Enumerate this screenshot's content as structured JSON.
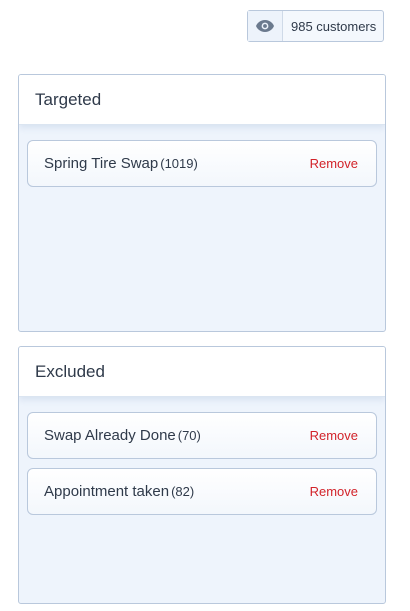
{
  "header": {
    "audience_count": "985 customers",
    "audience_icon": "eye-icon"
  },
  "colors": {
    "remove": "#d2232a",
    "panel_bg": "#eef4fc",
    "border": "#b9c8dc"
  },
  "targeted": {
    "title": "Targeted",
    "items": [
      {
        "name": "Spring Tire Swap",
        "count": "(1019)",
        "action": "Remove"
      }
    ]
  },
  "excluded": {
    "title": "Excluded",
    "items": [
      {
        "name": "Swap Already Done",
        "count": "(70)",
        "action": "Remove"
      },
      {
        "name": "Appointment taken",
        "count": "(82)",
        "action": "Remove"
      }
    ]
  }
}
